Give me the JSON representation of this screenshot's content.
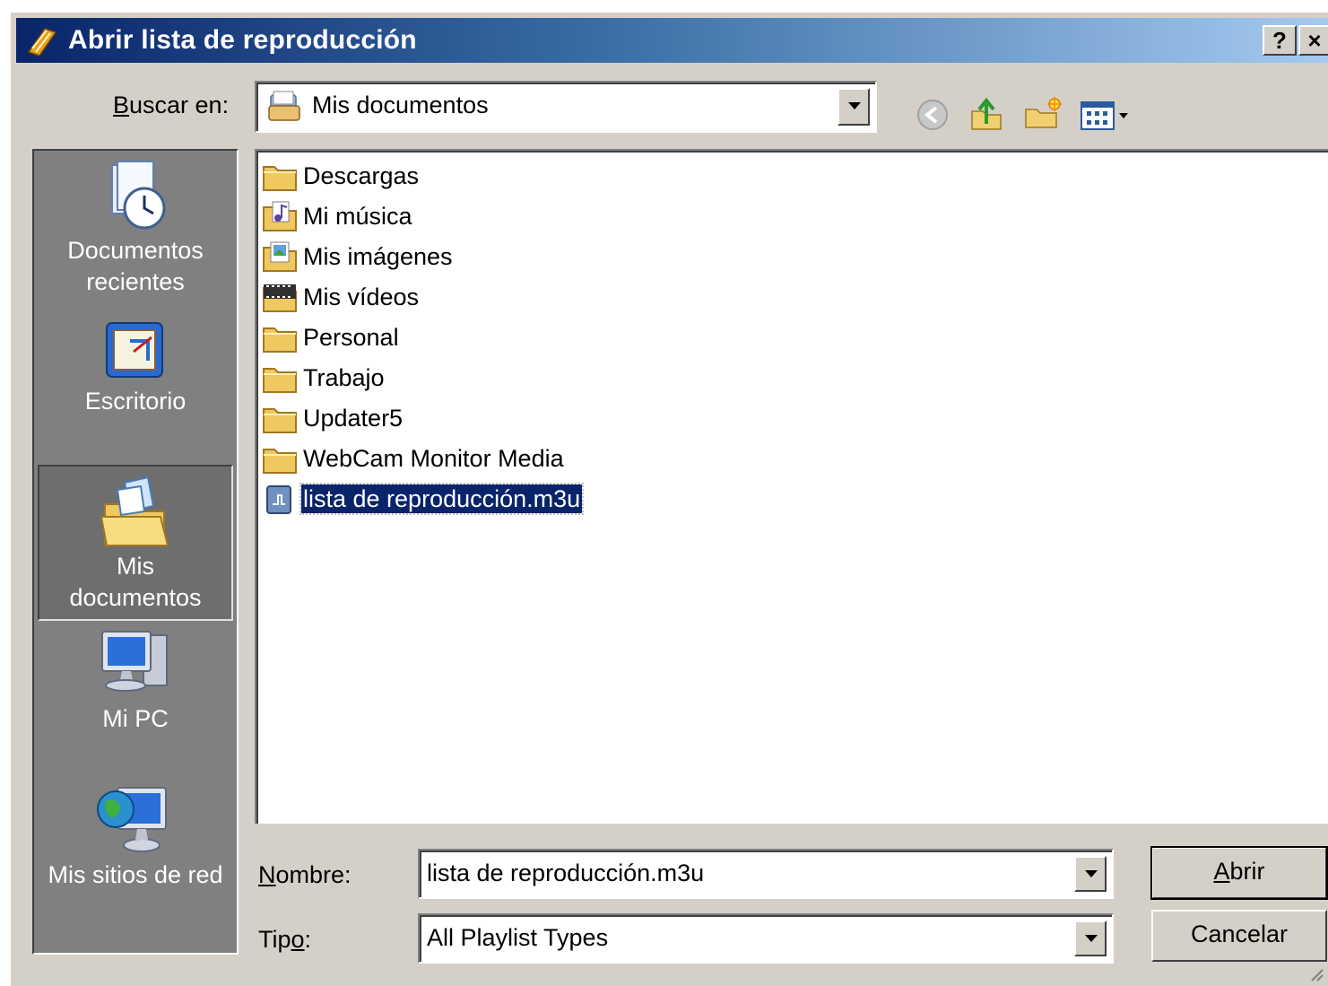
{
  "window": {
    "title": "Abrir lista de reproducción",
    "help_label": "?",
    "close_label": "×"
  },
  "lookin": {
    "label_prefix": "",
    "label_hotkey": "B",
    "label_rest": "uscar en:",
    "value": "Mis documentos"
  },
  "toolbar": {
    "back_icon": "back-arrow-icon",
    "up_icon": "up-folder-icon",
    "new_folder_icon": "new-folder-icon",
    "view_icon": "view-menu-icon"
  },
  "places": [
    {
      "line1": "Documentos",
      "line2": "recientes",
      "icon": "recent-documents-icon"
    },
    {
      "line1": "Escritorio",
      "line2": "",
      "icon": "desktop-icon"
    },
    {
      "line1": "Mis",
      "line2": "documentos",
      "icon": "my-documents-icon"
    },
    {
      "line1": "Mi PC",
      "line2": "",
      "icon": "my-computer-icon"
    },
    {
      "line1": "Mis sitios de red",
      "line2": "",
      "icon": "network-places-icon"
    }
  ],
  "files": [
    {
      "name": "Descargas",
      "icon": "folder-icon"
    },
    {
      "name": "Mi música",
      "icon": "music-folder-icon"
    },
    {
      "name": "Mis imágenes",
      "icon": "pictures-folder-icon"
    },
    {
      "name": "Mis vídeos",
      "icon": "video-folder-icon"
    },
    {
      "name": "Personal",
      "icon": "folder-icon"
    },
    {
      "name": "Trabajo",
      "icon": "folder-icon"
    },
    {
      "name": "Updater5",
      "icon": "folder-icon"
    },
    {
      "name": "WebCam Monitor Media",
      "icon": "folder-icon"
    },
    {
      "name": "lista de reproducción.m3u",
      "icon": "playlist-file-icon"
    }
  ],
  "filename": {
    "label_hotkey": "N",
    "label_rest": "ombre:",
    "value": "lista de reproducción.m3u"
  },
  "filetype": {
    "label_start": "Tip",
    "label_hotkey": "o",
    "label_end": ":",
    "value": "All Playlist Types"
  },
  "buttons": {
    "open_hotkey": "A",
    "open_rest": "brir",
    "cancel": "Cancelar"
  }
}
